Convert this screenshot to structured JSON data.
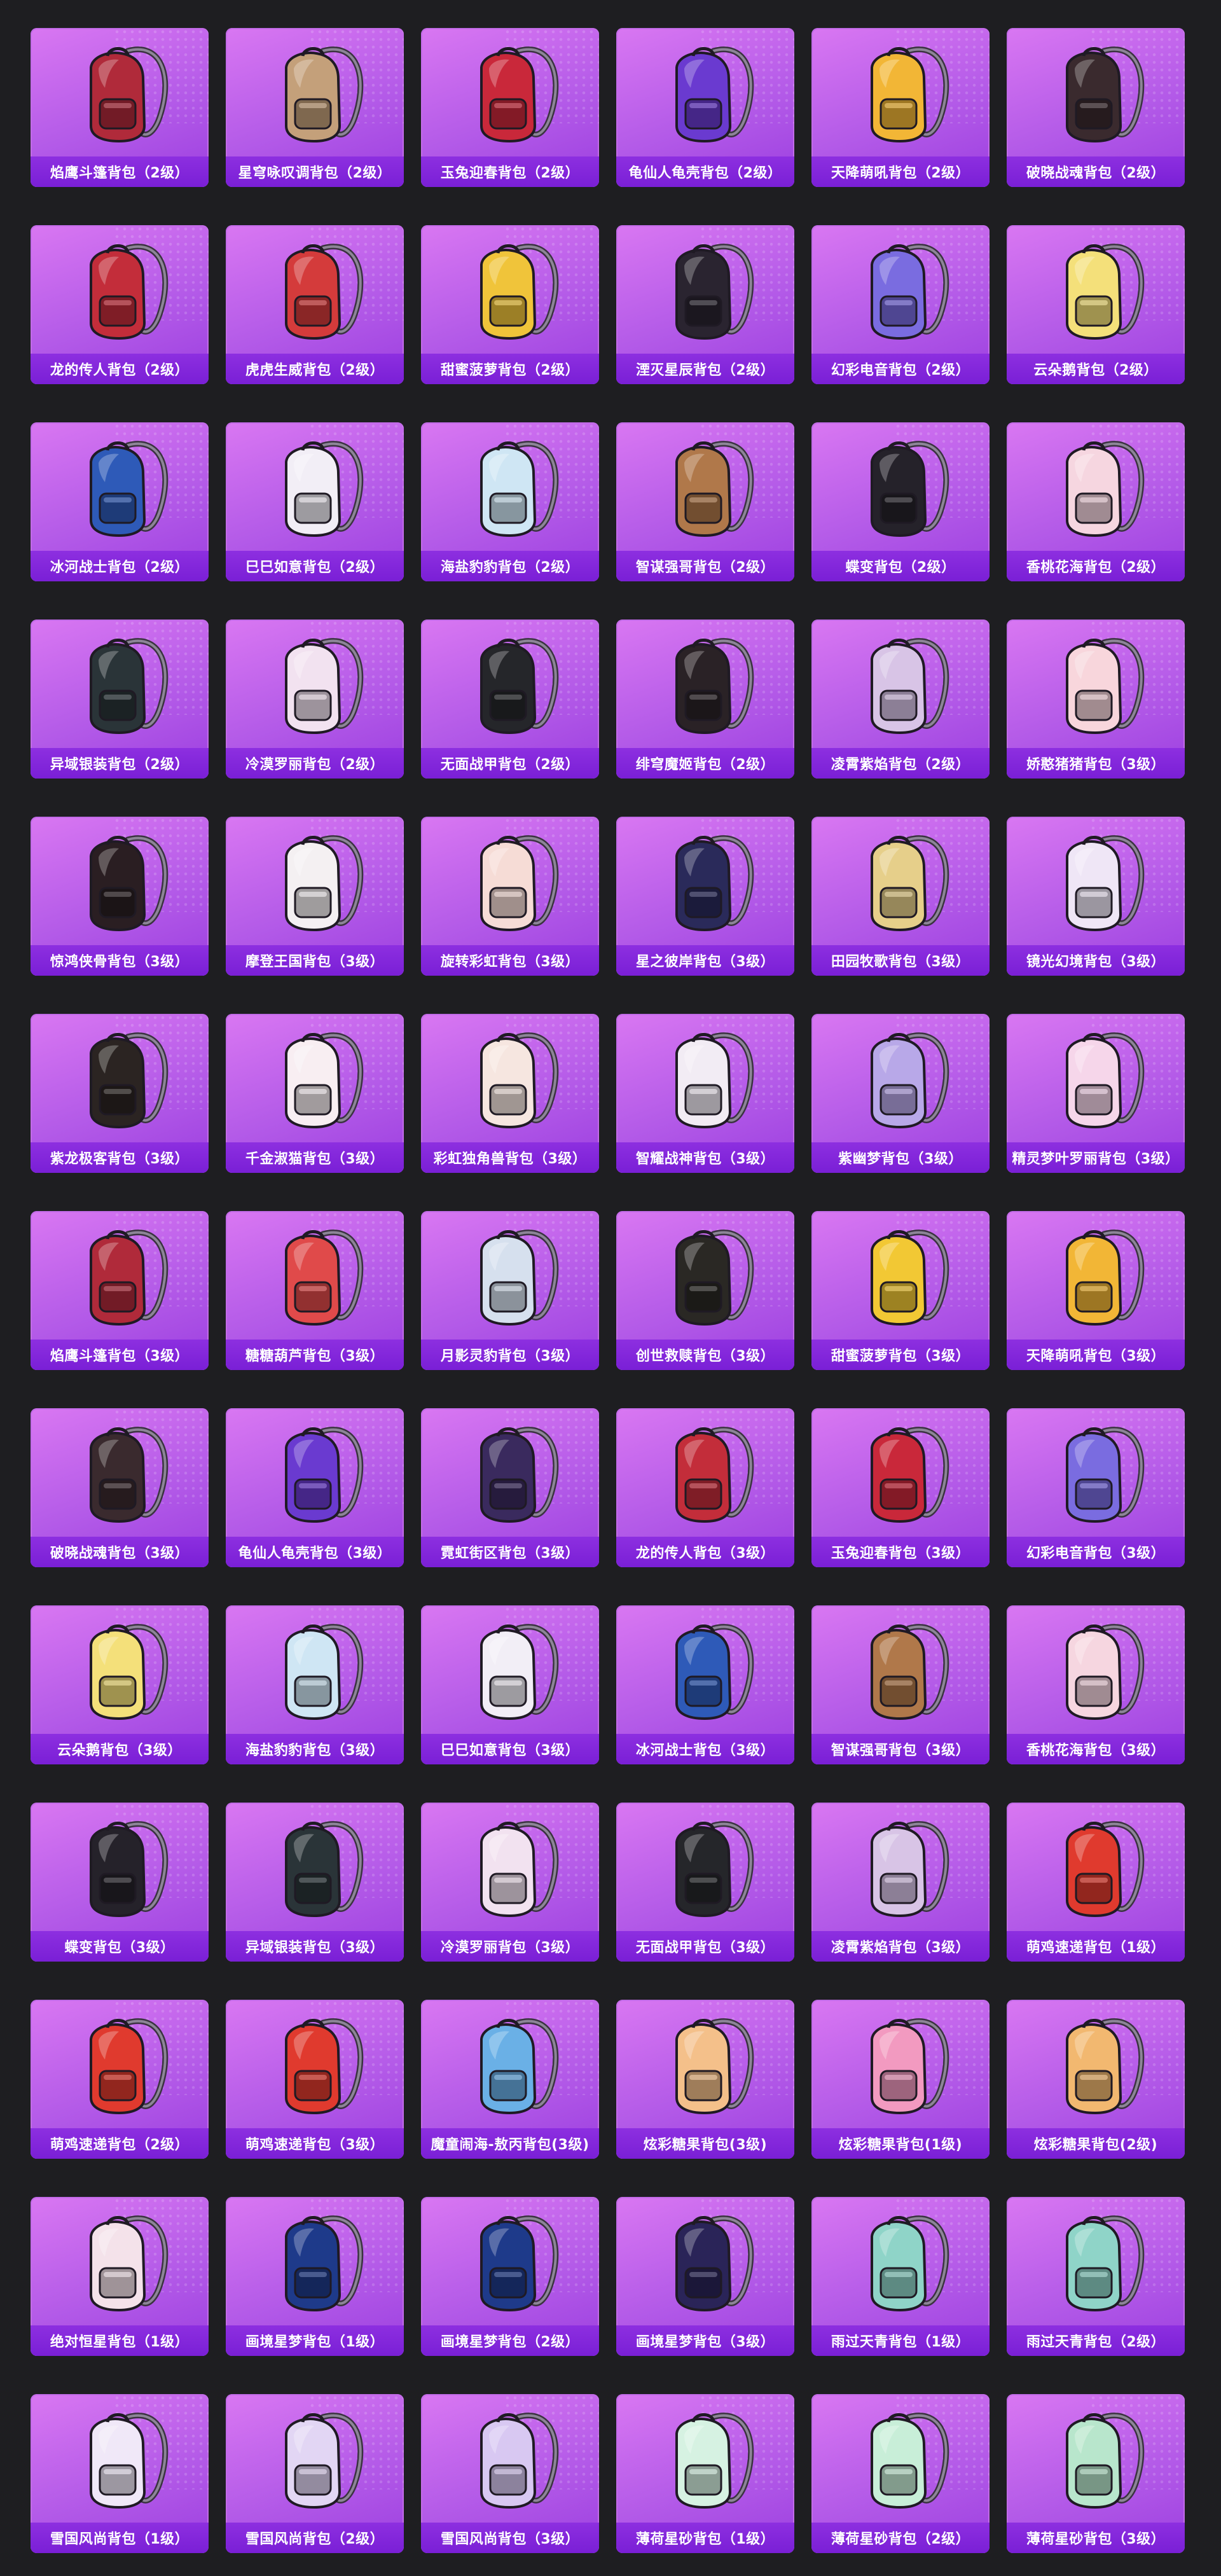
{
  "items": [
    {
      "name": "焰鹰斗篷背包（2级）",
      "icon": "backpack-icon",
      "color": "#b02a3a"
    },
    {
      "name": "星穹咏叹调背包（2级）",
      "icon": "backpack-icon",
      "color": "#c4a07a"
    },
    {
      "name": "玉兔迎春背包（2级）",
      "icon": "backpack-icon",
      "color": "#c9283a"
    },
    {
      "name": "龟仙人龟壳背包（2级）",
      "icon": "backpack-icon",
      "color": "#6a3ad0"
    },
    {
      "name": "天降萌吼背包（2级）",
      "icon": "backpack-icon",
      "color": "#f2b636"
    },
    {
      "name": "破晓战魂背包（2级）",
      "icon": "backpack-icon",
      "color": "#3a2a2e"
    },
    {
      "name": "龙的传人背包（2级）",
      "icon": "backpack-icon",
      "color": "#c32d3a"
    },
    {
      "name": "虎虎生威背包（2级）",
      "icon": "backpack-icon",
      "color": "#d43b3b"
    },
    {
      "name": "甜蜜菠萝背包（2级）",
      "icon": "backpack-icon",
      "color": "#f0c43a"
    },
    {
      "name": "湮灭星辰背包（2级）",
      "icon": "backpack-icon",
      "color": "#2a2430"
    },
    {
      "name": "幻彩电音背包（2级）",
      "icon": "backpack-icon",
      "color": "#7a6ce0"
    },
    {
      "name": "云朵鹅背包（2级）",
      "icon": "backpack-icon",
      "color": "#f4e07a"
    },
    {
      "name": "冰河战士背包（2级）",
      "icon": "backpack-icon",
      "color": "#2e5ab8"
    },
    {
      "name": "巳巳如意背包（2级）",
      "icon": "backpack-icon",
      "color": "#f2eef6"
    },
    {
      "name": "海盐豹豹背包（2级）",
      "icon": "backpack-icon",
      "color": "#cfe6f4"
    },
    {
      "name": "智谋强哥背包（2级）",
      "icon": "backpack-icon",
      "color": "#b0784a"
    },
    {
      "name": "蝶变背包（2级）",
      "icon": "backpack-icon",
      "color": "#25222a"
    },
    {
      "name": "香桃花海背包（2级）",
      "icon": "backpack-icon",
      "color": "#f6d6e0"
    },
    {
      "name": "异域银装背包（2级）",
      "icon": "backpack-icon",
      "color": "#2a3438"
    },
    {
      "name": "冷漠罗丽背包（2级）",
      "icon": "backpack-icon",
      "color": "#f2e2f0"
    },
    {
      "name": "无面战甲背包（2级）",
      "icon": "backpack-icon",
      "color": "#25262a"
    },
    {
      "name": "绯穹魔姬背包（2级）",
      "icon": "backpack-icon",
      "color": "#2a2226"
    },
    {
      "name": "凌霄紫焰背包（2级）",
      "icon": "backpack-icon",
      "color": "#d8c4e6"
    },
    {
      "name": "娇憨猪猪背包（3级）",
      "icon": "backpack-icon",
      "color": "#f8d6dc"
    },
    {
      "name": "惊鸿侠骨背包（3级）",
      "icon": "backpack-icon",
      "color": "#2a1e22"
    },
    {
      "name": "摩登王国背包（3级）",
      "icon": "backpack-icon",
      "color": "#f4f0f2"
    },
    {
      "name": "旋转彩虹背包（3级）",
      "icon": "backpack-icon",
      "color": "#f6dcd6"
    },
    {
      "name": "星之彼岸背包（3级）",
      "icon": "backpack-icon",
      "color": "#2a2a5a"
    },
    {
      "name": "田园牧歌背包（3级）",
      "icon": "backpack-icon",
      "color": "#e6cf8a"
    },
    {
      "name": "镜光幻境背包（3级）",
      "icon": "backpack-icon",
      "color": "#efe6f6"
    },
    {
      "name": "紫龙极客背包（3级）",
      "icon": "backpack-icon",
      "color": "#2b2422"
    },
    {
      "name": "千金淑猫背包（3级）",
      "icon": "backpack-icon",
      "color": "#f8eef2"
    },
    {
      "name": "彩虹独角兽背包（3级）",
      "icon": "backpack-icon",
      "color": "#f6e6e0"
    },
    {
      "name": "智耀战神背包（3级）",
      "icon": "backpack-icon",
      "color": "#f2ecf4"
    },
    {
      "name": "紫幽梦背包（3级）",
      "icon": "backpack-icon",
      "color": "#b8a8e8"
    },
    {
      "name": "精灵梦叶罗丽背包（3级）",
      "icon": "backpack-icon",
      "color": "#f6d6ea"
    },
    {
      "name": "焰鹰斗篷背包（3级）",
      "icon": "backpack-icon",
      "color": "#b02a3a"
    },
    {
      "name": "糖糖葫芦背包（3级）",
      "icon": "backpack-icon",
      "color": "#e04a4a"
    },
    {
      "name": "月影灵豹背包（3级）",
      "icon": "backpack-icon",
      "color": "#d6e0ee"
    },
    {
      "name": "创世救赎背包（3级）",
      "icon": "backpack-icon",
      "color": "#2a2824"
    },
    {
      "name": "甜蜜菠萝背包（3级）",
      "icon": "backpack-icon",
      "color": "#f2c834"
    },
    {
      "name": "天降萌吼背包（3级）",
      "icon": "backpack-icon",
      "color": "#f2b636"
    },
    {
      "name": "破晓战魂背包（3级）",
      "icon": "backpack-icon",
      "color": "#3a2a2e"
    },
    {
      "name": "龟仙人龟壳背包（3级）",
      "icon": "backpack-icon",
      "color": "#6a3ad0"
    },
    {
      "name": "霓虹街区背包（3级）",
      "icon": "backpack-icon",
      "color": "#3a2a5e"
    },
    {
      "name": "龙的传人背包（3级）",
      "icon": "backpack-icon",
      "color": "#c32d3a"
    },
    {
      "name": "玉兔迎春背包（3级）",
      "icon": "backpack-icon",
      "color": "#c9283a"
    },
    {
      "name": "幻彩电音背包（3级）",
      "icon": "backpack-icon",
      "color": "#7a6ce0"
    },
    {
      "name": "云朵鹅背包（3级）",
      "icon": "backpack-icon",
      "color": "#f4e07a"
    },
    {
      "name": "海盐豹豹背包（3级）",
      "icon": "backpack-icon",
      "color": "#cfe6f4"
    },
    {
      "name": "巳巳如意背包（3级）",
      "icon": "backpack-icon",
      "color": "#f2eef6"
    },
    {
      "name": "冰河战士背包（3级）",
      "icon": "backpack-icon",
      "color": "#2e5ab8"
    },
    {
      "name": "智谋强哥背包（3级）",
      "icon": "backpack-icon",
      "color": "#b0784a"
    },
    {
      "name": "香桃花海背包（3级）",
      "icon": "backpack-icon",
      "color": "#f6d6e0"
    },
    {
      "name": "蝶变背包（3级）",
      "icon": "backpack-icon",
      "color": "#25222a"
    },
    {
      "name": "异域银装背包（3级）",
      "icon": "backpack-icon",
      "color": "#2a3438"
    },
    {
      "name": "冷漠罗丽背包（3级）",
      "icon": "backpack-icon",
      "color": "#f2e2f0"
    },
    {
      "name": "无面战甲背包（3级）",
      "icon": "backpack-icon",
      "color": "#25262a"
    },
    {
      "name": "凌霄紫焰背包（3级）",
      "icon": "backpack-icon",
      "color": "#d8c4e6"
    },
    {
      "name": "萌鸡速递背包（1级）",
      "icon": "backpack-icon",
      "color": "#e03a2e"
    },
    {
      "name": "萌鸡速递背包（2级）",
      "icon": "backpack-icon",
      "color": "#e03a2e"
    },
    {
      "name": "萌鸡速递背包（3级）",
      "icon": "backpack-icon",
      "color": "#e03a2e"
    },
    {
      "name": "魔童闹海-敖丙背包(3级)",
      "icon": "backpack-icon",
      "color": "#6ab0e6"
    },
    {
      "name": "炫彩糖果背包(3级)",
      "icon": "backpack-icon",
      "color": "#f4c08a"
    },
    {
      "name": "炫彩糖果背包(1级)",
      "icon": "backpack-icon",
      "color": "#f29ac0"
    },
    {
      "name": "炫彩糖果背包(2级)",
      "icon": "backpack-icon",
      "color": "#f2b870"
    },
    {
      "name": "绝对恒星背包（1级）",
      "icon": "backpack-icon",
      "color": "#f4e2ea"
    },
    {
      "name": "画境星梦背包（1级）",
      "icon": "backpack-icon",
      "color": "#1e3a8a"
    },
    {
      "name": "画境星梦背包（2级）",
      "icon": "backpack-icon",
      "color": "#1e3a8a"
    },
    {
      "name": "画境星梦背包（3级）",
      "icon": "backpack-icon",
      "color": "#2a2458"
    },
    {
      "name": "雨过天青背包（1级）",
      "icon": "backpack-icon",
      "color": "#8fd4c8"
    },
    {
      "name": "雨过天青背包（2级）",
      "icon": "backpack-icon",
      "color": "#8fd4c8"
    },
    {
      "name": "雪国风尚背包（1级）",
      "icon": "backpack-icon",
      "color": "#f0e8f8"
    },
    {
      "name": "雪国风尚背包（2级）",
      "icon": "backpack-icon",
      "color": "#e2d6f4"
    },
    {
      "name": "雪国风尚背包（3级）",
      "icon": "backpack-icon",
      "color": "#d8c8f2"
    },
    {
      "name": "薄荷星砂背包（1级）",
      "icon": "backpack-icon",
      "color": "#d6f2e2"
    },
    {
      "name": "薄荷星砂背包（2级）",
      "icon": "backpack-icon",
      "color": "#c8eed8"
    },
    {
      "name": "薄荷星砂背包（3级）",
      "icon": "backpack-icon",
      "color": "#b8e6cc"
    }
  ]
}
